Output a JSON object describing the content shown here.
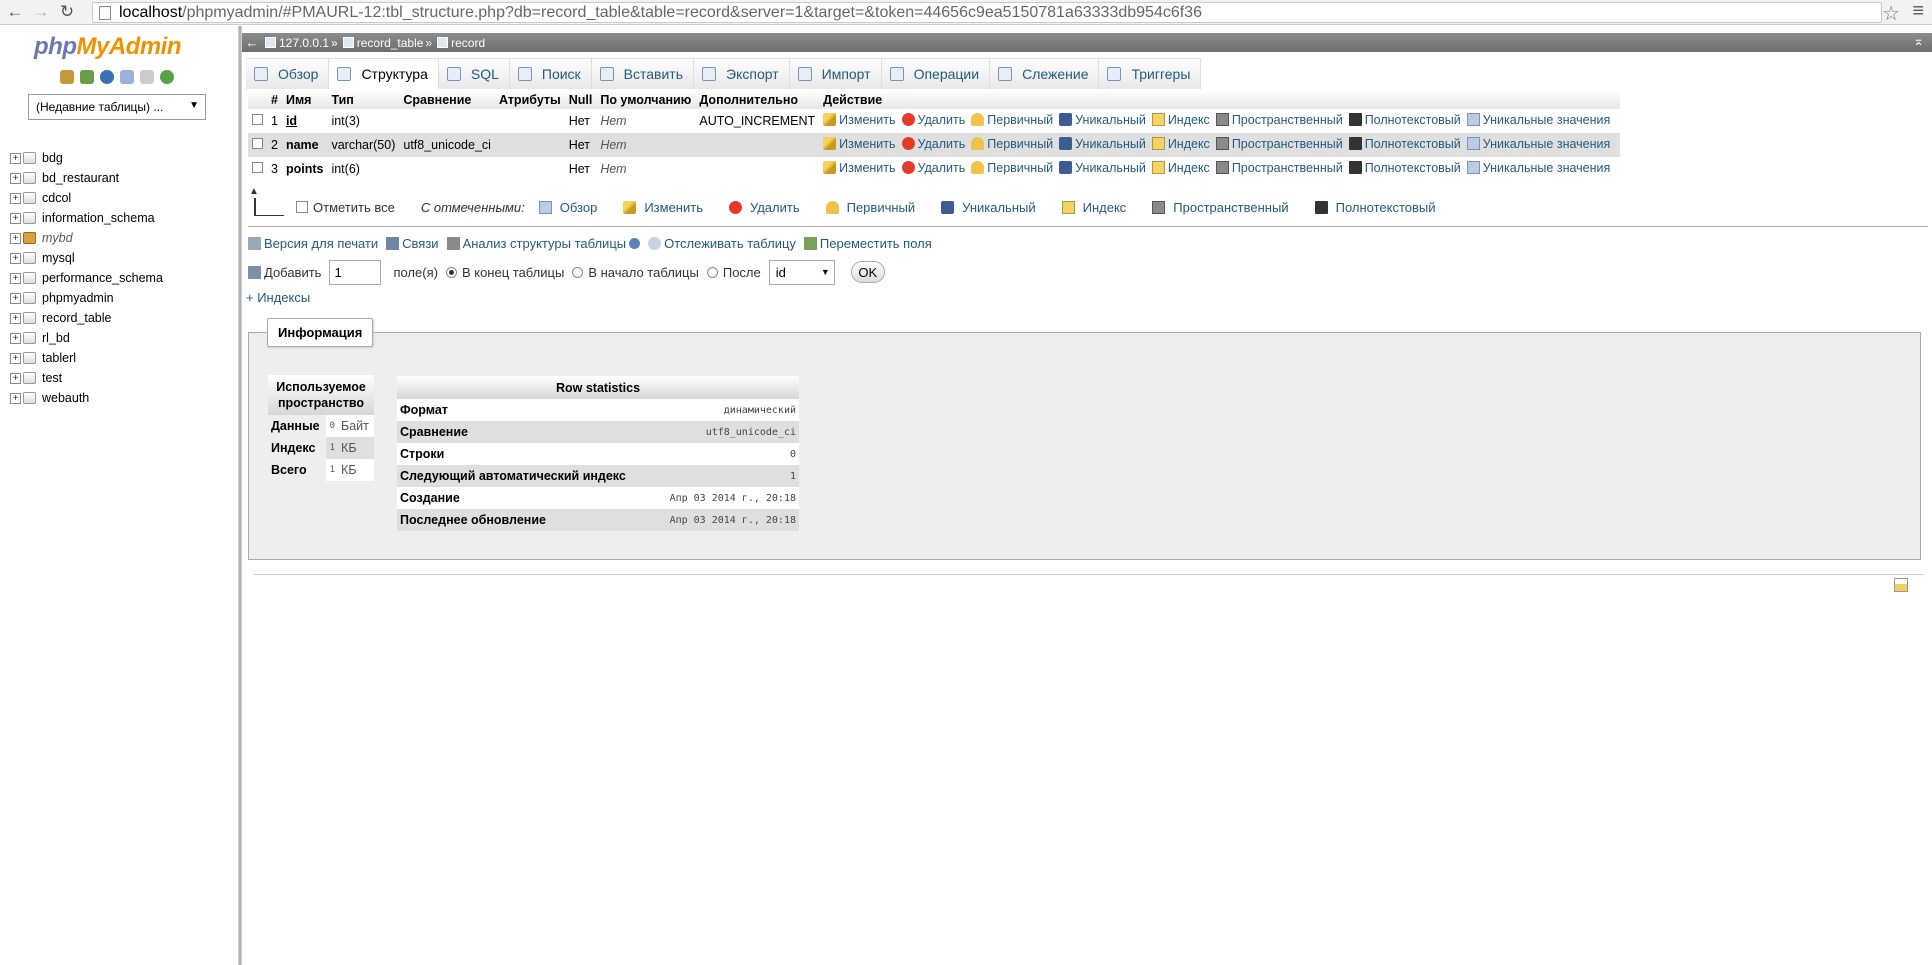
{
  "browser": {
    "url_host": "localhost",
    "url_path": "/phpmyadmin/#PMAURL-12:tbl_structure.php?db=record_table&table=record&server=1&target=&token=44656c9ea5150781a63333db954c6f36"
  },
  "logo": {
    "php": "php",
    "ma": "MyAdmin"
  },
  "sidebar": {
    "recent_tables": "(Недавние таблицы) ...",
    "databases": [
      {
        "name": "bdg",
        "italic": false
      },
      {
        "name": "bd_restaurant",
        "italic": false
      },
      {
        "name": "cdcol",
        "italic": false
      },
      {
        "name": "information_schema",
        "italic": false
      },
      {
        "name": "mybd",
        "italic": true
      },
      {
        "name": "mysql",
        "italic": false
      },
      {
        "name": "performance_schema",
        "italic": false
      },
      {
        "name": "phpmyadmin",
        "italic": false
      },
      {
        "name": "record_table",
        "italic": false
      },
      {
        "name": "rl_bd",
        "italic": false
      },
      {
        "name": "tablerl",
        "italic": false
      },
      {
        "name": "test",
        "italic": false
      },
      {
        "name": "webauth",
        "italic": false
      }
    ]
  },
  "breadcrumb": {
    "server": "127.0.0.1",
    "sep": "»",
    "database": "record_table",
    "table": "record"
  },
  "tabs": [
    "Обзор",
    "Структура",
    "SQL",
    "Поиск",
    "Вставить",
    "Экспорт",
    "Импорт",
    "Операции",
    "Слежение",
    "Триггеры"
  ],
  "columns_header": [
    "#",
    "Имя",
    "Тип",
    "Сравнение",
    "Атрибуты",
    "Null",
    "По умолчанию",
    "Дополнительно",
    "Действие"
  ],
  "columns": [
    {
      "num": "1",
      "name": "id",
      "type": "int(3)",
      "collation": "",
      "attributes": "",
      "null": "Нет",
      "default": "Нет",
      "extra": "AUTO_INCREMENT"
    },
    {
      "num": "2",
      "name": "name",
      "type": "varchar(50)",
      "collation": "utf8_unicode_ci",
      "attributes": "",
      "null": "Нет",
      "default": "Нет",
      "extra": ""
    },
    {
      "num": "3",
      "name": "points",
      "type": "int(6)",
      "collation": "",
      "attributes": "",
      "null": "Нет",
      "default": "Нет",
      "extra": ""
    }
  ],
  "row_actions": {
    "edit": "Изменить",
    "drop": "Удалить",
    "primary": "Первичный",
    "unique": "Уникальный",
    "index": "Индекс",
    "spatial": "Пространственный",
    "fulltext": "Полнотекстовый",
    "distinct": "Уникальные значения"
  },
  "bulk": {
    "check_all": "Отметить все",
    "with_selected": "С отмеченными:",
    "actions": [
      "Обзор",
      "Изменить",
      "Удалить",
      "Первичный",
      "Уникальный",
      "Индекс",
      "Пространственный",
      "Полнотекстовый"
    ]
  },
  "links": {
    "print": "Версия для печати",
    "relations": "Связи",
    "analyze": "Анализ структуры таблицы",
    "track": "Отслеживать таблицу",
    "move": "Переместить поля"
  },
  "add_field": {
    "label": "Добавить",
    "count": "1",
    "fields": "поле(я)",
    "at_end": "В конец таблицы",
    "at_beginning": "В начало таблицы",
    "after": "После",
    "after_column": "id",
    "go": "OK"
  },
  "indexes_link": "+ Индексы",
  "info": {
    "legend": "Информация",
    "space": {
      "header": "Используемое пространство",
      "rows": [
        {
          "label": "Данные",
          "value": "0",
          "unit": "Байт"
        },
        {
          "label": "Индекс",
          "value": "1",
          "unit": "КБ"
        },
        {
          "label": "Всего",
          "value": "1",
          "unit": "КБ"
        }
      ]
    },
    "stats": {
      "header": "Row statistics",
      "rows": [
        {
          "label": "Формат",
          "value": "динамический"
        },
        {
          "label": "Сравнение",
          "value": "utf8_unicode_ci"
        },
        {
          "label": "Строки",
          "value": "0"
        },
        {
          "label": "Следующий автоматический индекс",
          "value": "1"
        },
        {
          "label": "Создание",
          "value": "Апр 03 2014 г., 20:18"
        },
        {
          "label": "Последнее обновление",
          "value": "Апр 03 2014 г., 20:18"
        }
      ]
    }
  }
}
